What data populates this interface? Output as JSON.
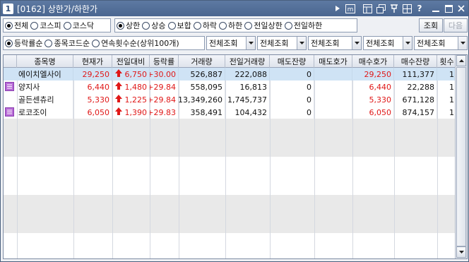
{
  "window": {
    "number": "1",
    "title": "[0162] 상한가/하한가"
  },
  "filter_market": {
    "options": [
      "전체",
      "코스피",
      "코스닥"
    ],
    "selected": 0
  },
  "filter_type": {
    "options": [
      "상한",
      "상승",
      "보합",
      "하락",
      "하한",
      "전일상한",
      "전일하한"
    ],
    "selected": 0
  },
  "buttons": {
    "query": "조회",
    "next": "다음"
  },
  "filter_sort": {
    "options": [
      "등락률순",
      "종목코드순",
      "연속횟수순(상위100개)"
    ],
    "selected": 0
  },
  "dropdowns": [
    "전체조회",
    "전체조회",
    "전체조회",
    "전체조회",
    "전체조회"
  ],
  "columns": [
    "종목명",
    "현재가",
    "전일대비",
    "등락률",
    "거래량",
    "전일거래량",
    "매도잔량",
    "매도호가",
    "매수호가",
    "매수잔량",
    "횟수"
  ],
  "rows": [
    {
      "name": "에이치엘사이",
      "price": "29,250",
      "change": "6,750",
      "rate": "+30.00",
      "volume": "526,887",
      "prev_volume": "222,088",
      "ask_qty": "0",
      "ask": "",
      "bid": "29,250",
      "bid_qty": "111,377",
      "count": "1",
      "icon": false,
      "selected": true
    },
    {
      "name": "양지사",
      "price": "6,440",
      "change": "1,480",
      "rate": "+29.84",
      "volume": "558,095",
      "prev_volume": "16,813",
      "ask_qty": "0",
      "ask": "",
      "bid": "6,440",
      "bid_qty": "22,288",
      "count": "1",
      "icon": true,
      "selected": false
    },
    {
      "name": "골든센츄리",
      "price": "5,330",
      "change": "1,225",
      "rate": "+29.84",
      "volume": "13,349,260",
      "prev_volume": "1,745,737",
      "ask_qty": "0",
      "ask": "",
      "bid": "5,330",
      "bid_qty": "671,128",
      "count": "1",
      "icon": false,
      "selected": false
    },
    {
      "name": "로코조이",
      "price": "6,050",
      "change": "1,390",
      "rate": "+29.83",
      "volume": "358,491",
      "prev_volume": "104,432",
      "ask_qty": "0",
      "ask": "",
      "bid": "6,050",
      "bid_qty": "874,157",
      "count": "1",
      "icon": true,
      "selected": false
    }
  ],
  "colors": {
    "up_red": "#e01818",
    "title_bar": "#4a6690",
    "selected_row": "#cfe3f5",
    "icon_purple": "#b76ad6"
  }
}
